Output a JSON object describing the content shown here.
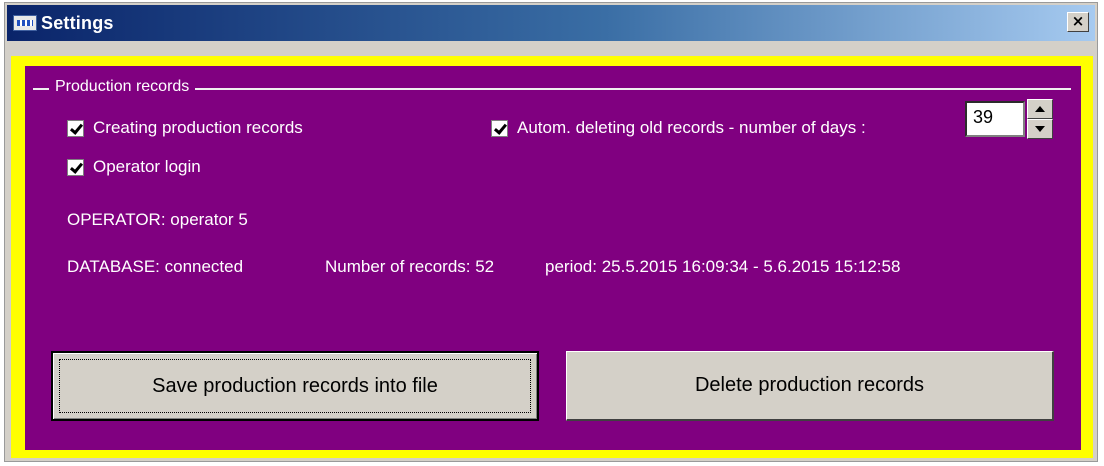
{
  "window": {
    "title": "Settings",
    "close_label": "×"
  },
  "group": {
    "title": "Production records"
  },
  "options": {
    "creating_records": {
      "label": "Creating production records",
      "checked": true
    },
    "operator_login": {
      "label": "Operator login",
      "checked": true
    },
    "auto_delete": {
      "label": "Autom. deleting old records - number of days :",
      "checked": true
    },
    "days_value": "39"
  },
  "status": {
    "operator": "OPERATOR: operator 5",
    "database": "DATABASE:  connected",
    "record_count": "Number of records:  52",
    "period": "period:  25.5.2015 16:09:34  -  5.6.2015 15:12:58"
  },
  "buttons": {
    "save": "Save production records into file",
    "delete": "Delete production records"
  },
  "colors": {
    "panel_background": "#800080",
    "frame_border": "#ffff00",
    "title_bar": "#0a246a"
  }
}
